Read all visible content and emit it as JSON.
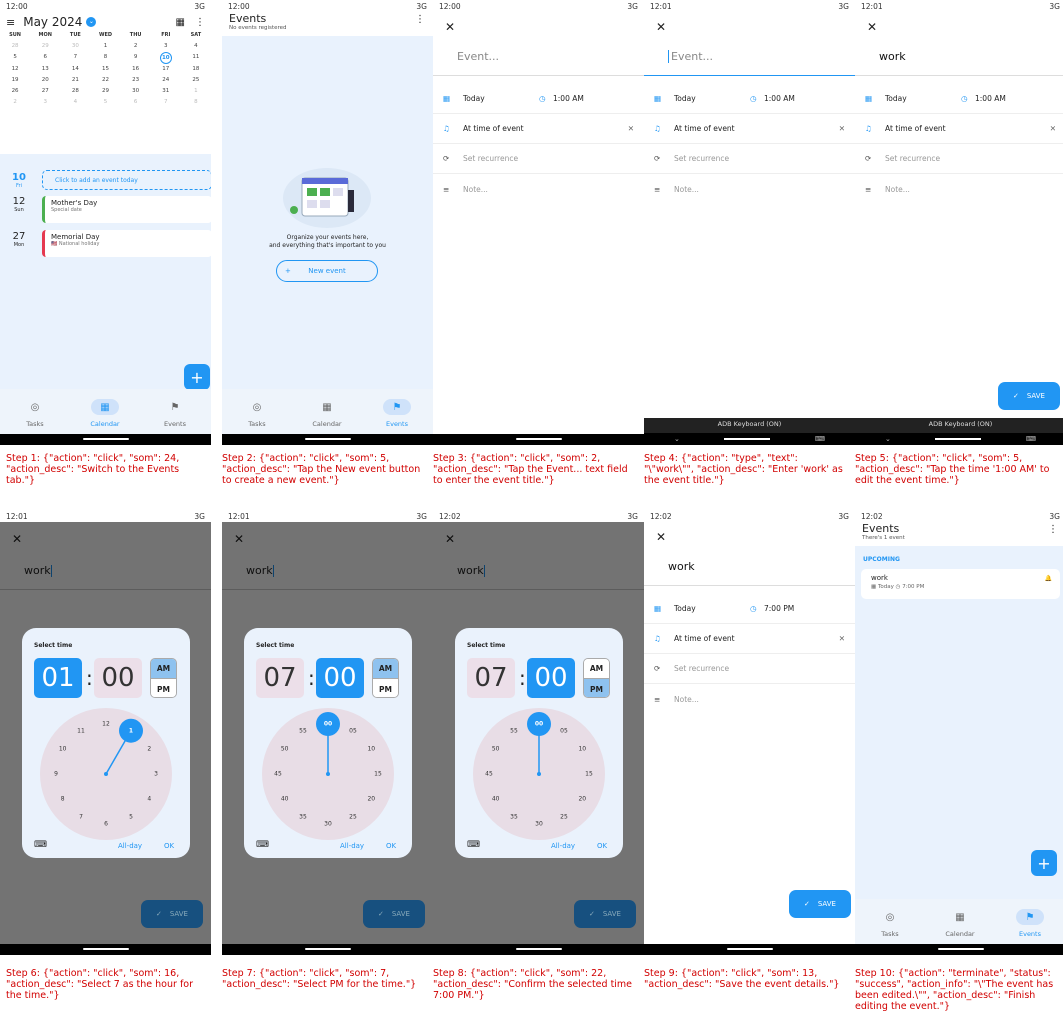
{
  "status_bar": {
    "times": [
      "12:00",
      "12:00",
      "12:00",
      "12:01",
      "12:01",
      "12:01",
      "12:01",
      "12:02",
      "12:02",
      "12:02"
    ],
    "network": "3G"
  },
  "bottom_nav": {
    "tasks": "Tasks",
    "calendar": "Calendar",
    "events": "Events"
  },
  "calendar": {
    "month": "May 2024",
    "dow": [
      "SUN",
      "MON",
      "TUE",
      "WED",
      "THU",
      "FRI",
      "SAT"
    ],
    "weeks": [
      [
        "28",
        "29",
        "30",
        "1",
        "2",
        "3",
        "4"
      ],
      [
        "5",
        "6",
        "7",
        "8",
        "9",
        "10",
        "11"
      ],
      [
        "12",
        "13",
        "14",
        "15",
        "16",
        "17",
        "18"
      ],
      [
        "19",
        "20",
        "21",
        "22",
        "23",
        "24",
        "25"
      ],
      [
        "26",
        "27",
        "28",
        "29",
        "30",
        "31",
        "1"
      ],
      [
        "2",
        "3",
        "4",
        "5",
        "6",
        "7",
        "8"
      ]
    ],
    "today": "10",
    "add_event_prompt": "Click to add an event today",
    "day_labels": [
      {
        "num": "10",
        "dow": "Fri"
      },
      {
        "num": "12",
        "dow": "Sun"
      },
      {
        "num": "27",
        "dow": "Mon"
      }
    ],
    "holidays": [
      {
        "name": "Mother's Day",
        "type": "Special date"
      },
      {
        "name": "Memorial Day",
        "type": "National holiday"
      }
    ],
    "colors": {
      "accent": "#2196f3",
      "mothers_day": "#4caf50",
      "memorial_day": "#e53950"
    }
  },
  "events_empty": {
    "title": "Events",
    "subtitle": "No events registered",
    "illustration_caption_1": "Organize your events here,",
    "illustration_caption_2": "and everything that's important to you",
    "new_event_button": "New event"
  },
  "editor": {
    "title_placeholder": "Event...",
    "title_value": "work",
    "date": "Today",
    "time_initial": "1:00 AM",
    "time_final": "7:00 PM",
    "reminder": "At time of event",
    "recurrence": "Set recurrence",
    "note": "Note...",
    "save": "SAVE",
    "keyboard": "ADB Keyboard (ON)"
  },
  "time_picker": {
    "title": "Select time",
    "hour_initial": "01",
    "hour_selected": "07",
    "minute": "00",
    "am": "AM",
    "pm": "PM",
    "all_day": "All-day",
    "ok": "OK",
    "hours": [
      "12",
      "1",
      "2",
      "3",
      "4",
      "5",
      "6",
      "7",
      "8",
      "9",
      "10",
      "11"
    ],
    "minutes": [
      "00",
      "05",
      "10",
      "15",
      "20",
      "25",
      "30",
      "35",
      "40",
      "45",
      "50",
      "55"
    ]
  },
  "events_final": {
    "title": "Events",
    "subtitle": "There's 1 event",
    "section": "UPCOMING",
    "event_name": "work",
    "event_date": "Today",
    "event_time": "7:00 PM"
  },
  "captions": [
    "Step 1: {\"action\": \"click\", \"som\": 24, \"action_desc\": \"Switch to the Events tab.\"}",
    "Step 2: {\"action\": \"click\", \"som\": 5, \"action_desc\": \"Tap the New event button to create a new event.\"}",
    "Step 3: {\"action\": \"click\", \"som\": 2, \"action_desc\": \"Tap the Event... text field to enter the event title.\"}",
    "Step 4: {\"action\": \"type\", \"text\": \"\\\"work\\\"\", \"action_desc\": \"Enter 'work' as the event title.\"}",
    "Step 5: {\"action\": \"click\", \"som\": 5, \"action_desc\": \"Tap the time '1:00 AM' to edit the event time.\"}",
    "Step 6: {\"action\": \"click\", \"som\": 16, \"action_desc\": \"Select 7 as the hour for the time.\"}",
    "Step 7: {\"action\": \"click\", \"som\": 7, \"action_desc\": \"Select PM for the time.\"}",
    "Step 8: {\"action\": \"click\", \"som\": 22, \"action_desc\": \"Confirm the selected time 7:00 PM.\"}",
    "Step 9: {\"action\": \"click\", \"som\": 13, \"action_desc\": \"Save the event details.\"}",
    "Step 10: {\"action\": \"terminate\", \"status\": \"success\", \"action_info\": \"\\\"The event has been edited.\\\"\", \"action_desc\": \"Finish editing the event.\"}"
  ]
}
